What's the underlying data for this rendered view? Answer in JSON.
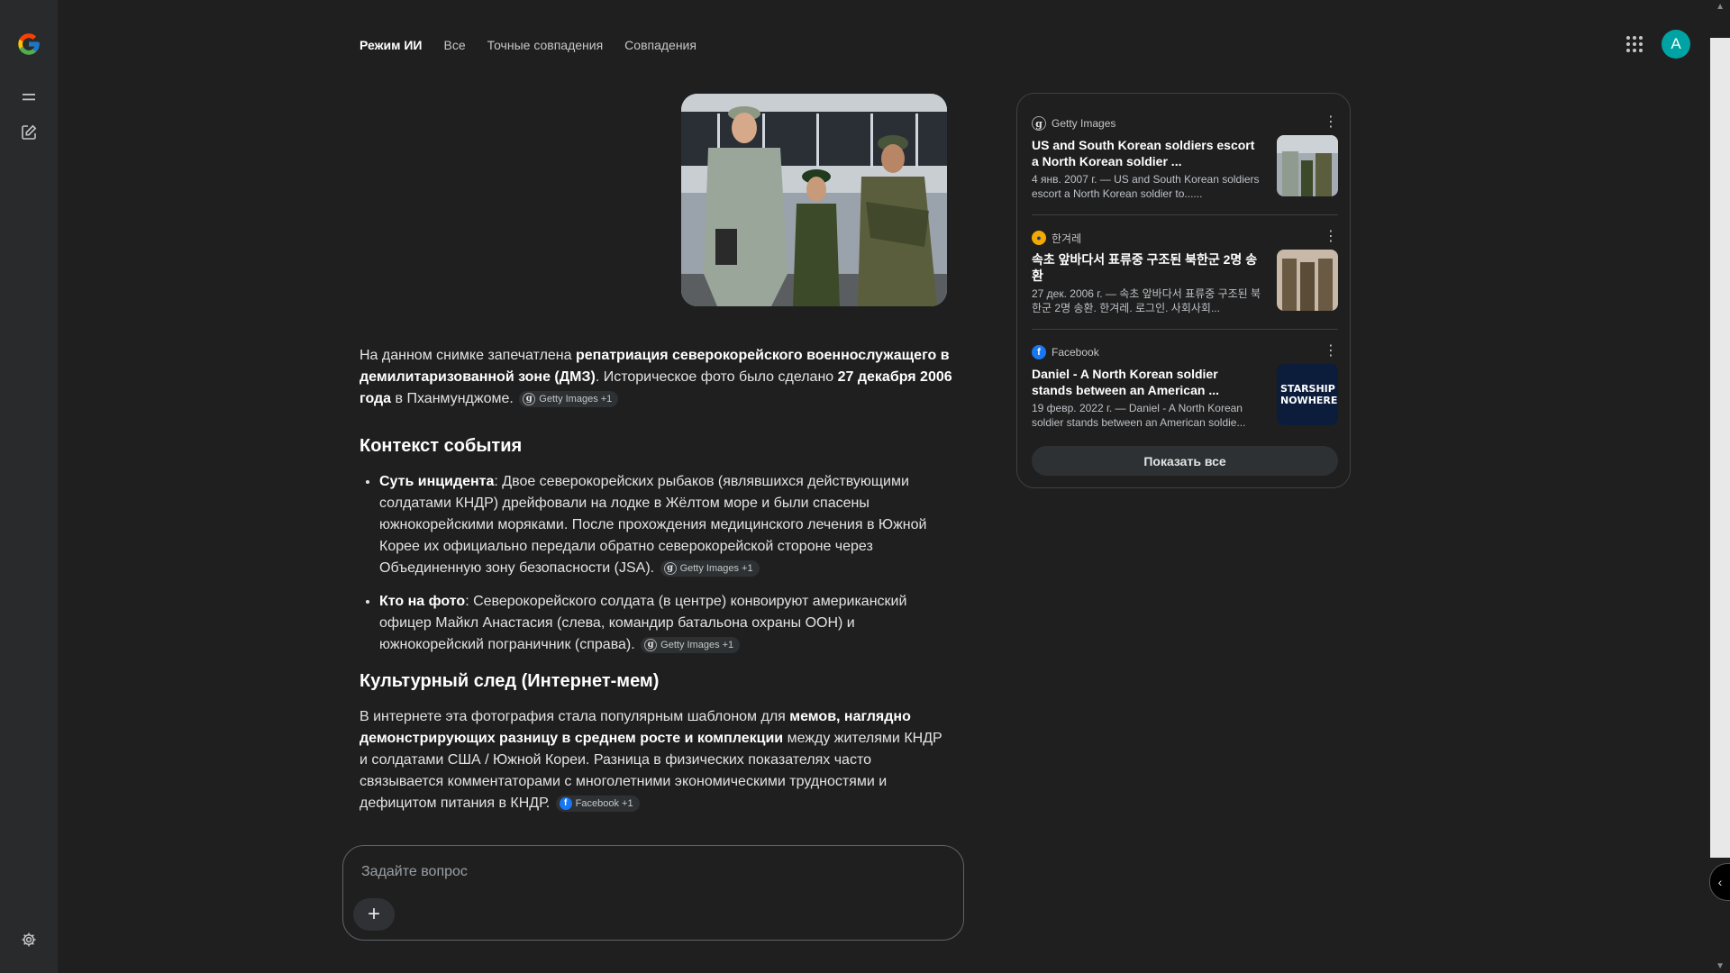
{
  "rail": {
    "logo": "google-g-logo",
    "menu_icon": "menu-icon",
    "new_chat_icon": "edit-icon",
    "settings_icon": "gear-icon"
  },
  "tabs": [
    {
      "label": "Режим ИИ",
      "active": true
    },
    {
      "label": "Все",
      "active": false
    },
    {
      "label": "Точные совпадения",
      "active": false
    },
    {
      "label": "Совпадения",
      "active": false
    }
  ],
  "header": {
    "apps_icon": "apps-grid-icon",
    "avatar_letter": "A",
    "avatar_color": "#00a3a3"
  },
  "answer": {
    "intro": {
      "t1": "На данном снимке запечатлена ",
      "b1": "репатриация северокорейского военнослужащего в демилитаризованной зоне (ДМЗ)",
      "t2": ". Историческое фото было сделано ",
      "b2": "27 декабря 2006 года",
      "t3": " в Пханмунджоме.",
      "chip": "Getty Images +1"
    },
    "section1_title": "Контекст события",
    "bullets": [
      {
        "lead": "Суть инцидента",
        "text": ": Двое северокорейских рыбаков (являвшихся действующими солдатами КНДР) дрейфовали на лодке в Жёлтом море и были спасены южнокорейскими моряками. После прохождения медицинского лечения в Южной Корее их официально передали обратно северокорейской стороне через Объединенную зону безопасности (JSA).",
        "chip": "Getty Images +1"
      },
      {
        "lead": "Кто на фото",
        "text": ": Северокорейского солдата (в центре) конвоируют американский офицер Майкл Анастасия (слева, командир батальона охраны ООН) и южнокорейский пограничник (справа).",
        "chip": "Getty Images +1"
      }
    ],
    "section2_title": "Культурный след (Интернет-мем)",
    "outro": {
      "t1": "В интернете эта фотография стала популярным шаблоном для ",
      "b1": "мемов, наглядно демонстрирующих разницу в среднем росте и комплекции",
      "t2": " между жителями КНДР и солдатами США / Южной Кореи. Разница в физических показателях часто связывается комментаторами с многолетними экономическими трудностями и дефицитом питания в КНДР.",
      "chip": "Facebook +1"
    }
  },
  "prompt": {
    "placeholder": "Задайте вопрос",
    "plus_icon": "plus-icon"
  },
  "sources": [
    {
      "site": "Getty Images",
      "logo_color": "#e3e3e3",
      "title": "US and South Korean soldiers escort a North Korean soldier ...",
      "snippet": "4 янв. 2007 г. — US and South Korean soldiers escort a North Korean soldier to......"
    },
    {
      "site": "한겨레",
      "logo_color": "#f2a900",
      "title": "속초 앞바다서 표류중 구조된 북한군 2명 송환",
      "snippet": "27 дек. 2006 г. — 속초 앞바다서 표류중 구조된 북한군 2명 송환. 한겨레. 로그인. 사회사회..."
    },
    {
      "site": "Facebook",
      "logo_color": "#1877f2",
      "title": "Daniel - A North Korean soldier stands between an American ...",
      "snippet": "19 февр. 2022 г. — Daniel - A North Korean soldier stands between an American soldie...",
      "thumb_text": "STARSHIP NOWHERE"
    }
  ],
  "show_all_label": "Показать все"
}
